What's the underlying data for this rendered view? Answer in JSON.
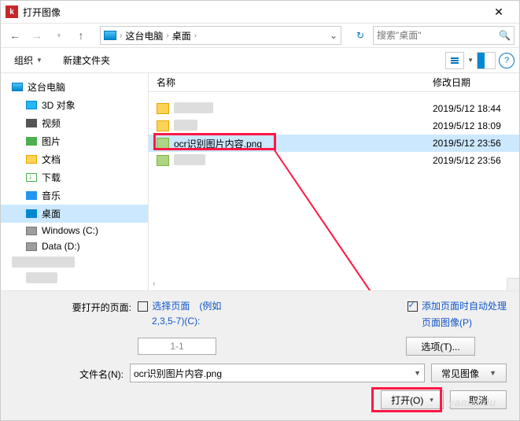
{
  "title": "打开图像",
  "breadcrumb": {
    "seg1": "这台电脑",
    "seg2": "桌面"
  },
  "search": {
    "placeholder": "搜索\"桌面\""
  },
  "toolbar": {
    "organize": "组织",
    "new_folder": "新建文件夹"
  },
  "sidebar": {
    "root": "这台电脑",
    "items": [
      "3D 对象",
      "视频",
      "图片",
      "文档",
      "下载",
      "音乐",
      "桌面",
      "Windows (C:)",
      "Data (D:)"
    ]
  },
  "file_header": {
    "name": "名称",
    "date": "修改日期"
  },
  "files": [
    {
      "name": "",
      "date": "2019/5/12 18:44"
    },
    {
      "name": "",
      "date": "2019/5/12 18:09"
    },
    {
      "name": "ocr识别图片内容.png",
      "date": "2019/5/12 23:56",
      "selected": true
    },
    {
      "name": "",
      "date": "2019/5/12 23:56"
    }
  ],
  "bottom": {
    "pages_label": "要打开的页面:",
    "select_pages": "选择页面",
    "select_hint": "(例如",
    "select_hint2": "2,3,5-7)(C):",
    "page_value": "1-1",
    "auto_process": "添加页面时自动处理",
    "auto_process2": "页面图像(P)",
    "filename_label": "文件名(N):",
    "filename_value": "ocr识别图片内容.png",
    "filter": "常见图像",
    "options": "选项(T)...",
    "open": "打开(O)",
    "cancel": "取消"
  },
  "watermark": "yanbaidu"
}
